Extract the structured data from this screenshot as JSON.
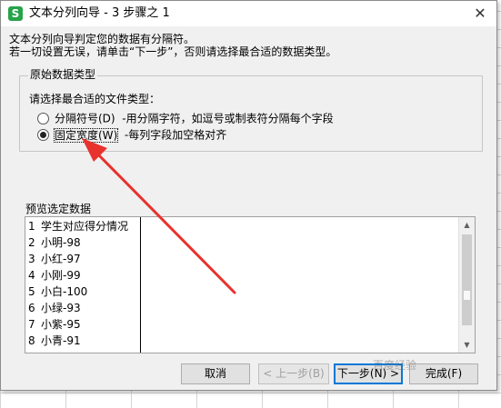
{
  "window": {
    "app_icon_letter": "S",
    "title": "文本分列向导 - 3 步骤之 1",
    "close_symbol": "✕"
  },
  "description": {
    "line1": "文本分列向导判定您的数据有分隔符。",
    "line2": "若一切设置无误，请单击“下一步”，否则请选择最合适的数据类型。"
  },
  "original_type": {
    "legend": "原始数据类型",
    "prompt": "请选择最合适的文件类型：",
    "options": [
      {
        "label": "分隔符号(D)",
        "description": "-用分隔字符，如逗号或制表符分隔每个字段",
        "selected": false
      },
      {
        "label": "固定宽度(W)",
        "description": "-每列字段加空格对齐",
        "selected": true
      }
    ]
  },
  "preview": {
    "label": "预览选定数据",
    "rows": [
      {
        "num": "1",
        "text": "学生对应得分情况"
      },
      {
        "num": "2",
        "text": "小明-98"
      },
      {
        "num": "3",
        "text": "小红-97"
      },
      {
        "num": "4",
        "text": "小刚-99"
      },
      {
        "num": "5",
        "text": "小白-100"
      },
      {
        "num": "6",
        "text": "小绿-93"
      },
      {
        "num": "7",
        "text": "小紫-95"
      },
      {
        "num": "8",
        "text": "小青-91"
      }
    ]
  },
  "buttons": {
    "cancel": "取消",
    "back": "< 上一步(B)",
    "next": "下一步(N) >",
    "finish": "完成(F)"
  },
  "watermark": "百度经验",
  "colors": {
    "annotation_arrow": "#e8322d",
    "app_icon": "#27a34a",
    "default_button_border": "#0078d7"
  }
}
